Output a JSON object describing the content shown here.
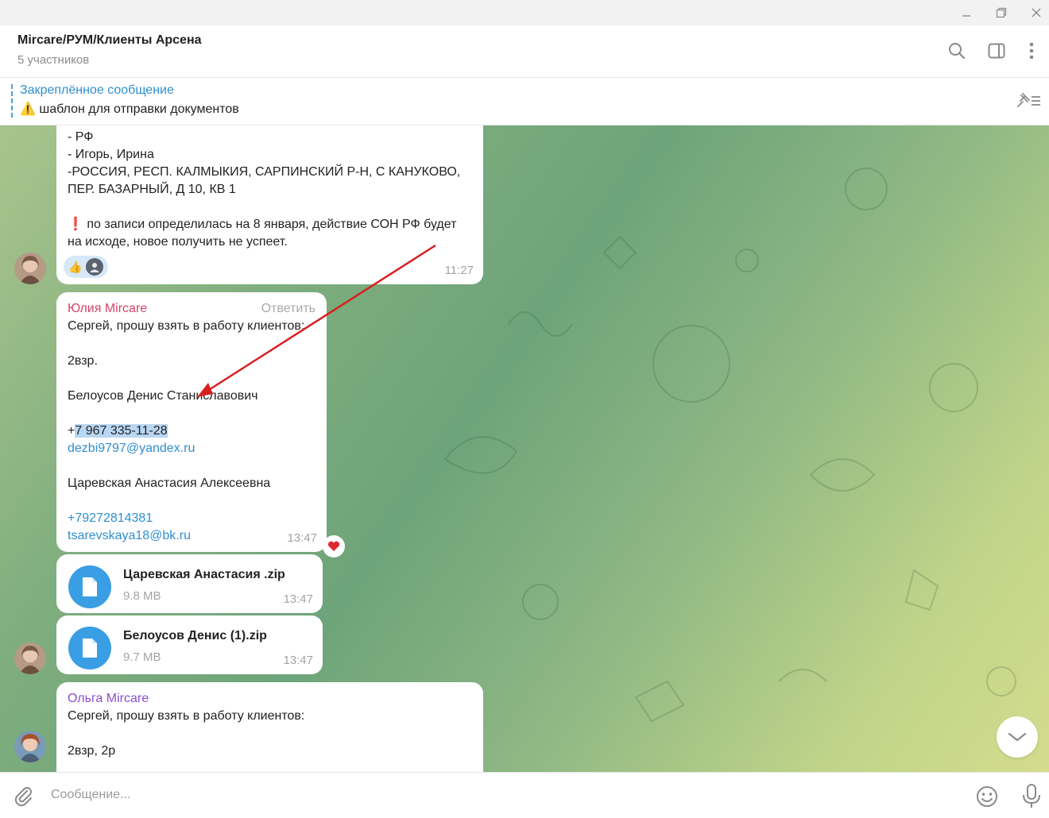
{
  "window": {
    "minimize_icon": "minimize-icon",
    "restore_icon": "restore-icon",
    "close_icon": "close-icon"
  },
  "header": {
    "title": "Mircare/РУМ/Клиенты Арсена",
    "subtitle": "5 участников",
    "icons": [
      "search-icon",
      "sidebar-toggle-icon",
      "more-vertical-icon"
    ]
  },
  "pinned": {
    "title": "Закреплённое сообщение",
    "emoji": "⚠️",
    "text": "шаблон для отправки документов"
  },
  "messages": {
    "m1": {
      "lines": [
        "- РФ",
        "- Игорь, Ирина",
        "-РОССИЯ, РЕСП. КАЛМЫКИЯ, САРПИНСКИЙ Р-Н, С КАНУКОВО,",
        "ПЕР. БАЗАРНЫЙ, Д 10, КВ 1",
        "",
        "по записи определилась на 8 января, действие СОН РФ будет",
        "на исходе, новое получить не успеет."
      ],
      "exclamation": "❗",
      "time": "11:27",
      "reaction": "👍"
    },
    "m2": {
      "sender": "Юлия Mircare",
      "reply": "Ответить",
      "lines": [
        "Сергей, прошу взять в работу клиентов:",
        "",
        "2взр.",
        "",
        "Белоусов Денис Станиславович",
        ""
      ],
      "phone_prefix": "+",
      "phone_selected": "7 967 335-11-28",
      "email1": "dezbi9797@yandex.ru",
      "name2": "Царевская Анастасия Алексеевна",
      "phone2": "+79272814381",
      "email2": "tsarevskaya18@bk.ru",
      "time": "13:47",
      "reaction": "❤️"
    },
    "file1": {
      "name": "Царевская Анастасия .zip",
      "size": "9.8 MB",
      "time": "13:47"
    },
    "file2": {
      "name": "Белоусов Денис (1).zip",
      "size": "9.7 MB",
      "time": "13:47"
    },
    "m3": {
      "sender": "Ольга Mircare",
      "lines": [
        "Сергей, прошу взять в работу клиентов:",
        "",
        "2взр, 2р"
      ]
    }
  },
  "composer": {
    "placeholder": "Сообщение..."
  },
  "colors": {
    "accent": "#3a9ee4",
    "link": "#2f8fd0",
    "sender_pink": "#d5436e",
    "sender_purple": "#8b4fd0",
    "annotation_arrow": "#d62020"
  }
}
